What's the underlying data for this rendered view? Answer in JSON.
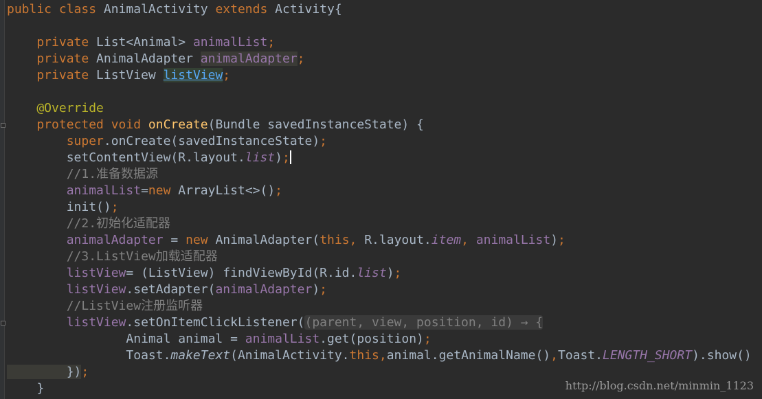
{
  "editor": {
    "lines": [
      [
        {
          "t": "public class ",
          "c": "kw"
        },
        {
          "t": "AnimalActivity ",
          "c": "pl"
        },
        {
          "t": "extends ",
          "c": "kw"
        },
        {
          "t": "Activity{",
          "c": "pl"
        }
      ],
      [],
      [
        {
          "t": "    private ",
          "c": "kw"
        },
        {
          "t": "List<Animal> ",
          "c": "pl"
        },
        {
          "t": "animalList",
          "c": "fld"
        },
        {
          "t": ";",
          "c": "kw"
        }
      ],
      [
        {
          "t": "    private ",
          "c": "kw"
        },
        {
          "t": "AnimalAdapter ",
          "c": "pl"
        },
        {
          "t": "animalAdapter",
          "c": "fld hl-usage"
        },
        {
          "t": ";",
          "c": "kw"
        }
      ],
      [
        {
          "t": "    private ",
          "c": "kw"
        },
        {
          "t": "ListView ",
          "c": "pl"
        },
        {
          "t": "listView",
          "c": "hl-link"
        },
        {
          "t": ";",
          "c": "kw"
        }
      ],
      [],
      [
        {
          "t": "    @Override",
          "c": "ann"
        }
      ],
      [
        {
          "t": "    protected void ",
          "c": "kw"
        },
        {
          "t": "onCreate",
          "c": "fn"
        },
        {
          "t": "(Bundle savedInstanceState) {",
          "c": "pl"
        }
      ],
      [
        {
          "t": "        super",
          "c": "kw"
        },
        {
          "t": ".onCreate(savedInstanceState)",
          "c": "pl"
        },
        {
          "t": ";",
          "c": "kw"
        }
      ],
      [
        {
          "t": "        setContentView(R.layout.",
          "c": "pl"
        },
        {
          "t": "list",
          "c": "fldi"
        },
        {
          "t": ")",
          "c": "pl"
        },
        {
          "t": ";",
          "c": "kw"
        },
        {
          "t": "",
          "c": "caret"
        }
      ],
      [
        {
          "t": "        //1.准备数据源",
          "c": "cmt"
        }
      ],
      [
        {
          "t": "        animalList",
          "c": "fld"
        },
        {
          "t": "=",
          "c": "pl"
        },
        {
          "t": "new ",
          "c": "kw"
        },
        {
          "t": "ArrayList<>()",
          "c": "pl"
        },
        {
          "t": ";",
          "c": "kw"
        }
      ],
      [
        {
          "t": "        init()",
          "c": "pl"
        },
        {
          "t": ";",
          "c": "kw"
        }
      ],
      [
        {
          "t": "        //2.初始化适配器",
          "c": "cmt"
        }
      ],
      [
        {
          "t": "        animalAdapter ",
          "c": "fld"
        },
        {
          "t": "= ",
          "c": "pl"
        },
        {
          "t": "new ",
          "c": "kw"
        },
        {
          "t": "AnimalAdapter(",
          "c": "pl"
        },
        {
          "t": "this, ",
          "c": "kw"
        },
        {
          "t": "R.layout.",
          "c": "pl"
        },
        {
          "t": "item",
          "c": "fldi"
        },
        {
          "t": ", ",
          "c": "kw"
        },
        {
          "t": "animalList",
          "c": "fld"
        },
        {
          "t": ")",
          "c": "pl"
        },
        {
          "t": ";",
          "c": "kw"
        }
      ],
      [
        {
          "t": "        //3.ListView加载适配器",
          "c": "cmt"
        }
      ],
      [
        {
          "t": "        listView",
          "c": "fld"
        },
        {
          "t": "= (ListView) findViewById(R.id.",
          "c": "pl"
        },
        {
          "t": "list",
          "c": "fldi"
        },
        {
          "t": ")",
          "c": "pl"
        },
        {
          "t": ";",
          "c": "kw"
        }
      ],
      [
        {
          "t": "        listView",
          "c": "fld"
        },
        {
          "t": ".setAdapter(",
          "c": "pl"
        },
        {
          "t": "animalAdapter",
          "c": "fld"
        },
        {
          "t": ")",
          "c": "pl"
        },
        {
          "t": ";",
          "c": "kw"
        }
      ],
      [
        {
          "t": "        //ListView注册监听器",
          "c": "cmt"
        }
      ],
      [
        {
          "t": "        listView",
          "c": "fld"
        },
        {
          "t": ".setOnItemClickListener(",
          "c": "pl"
        },
        {
          "t": "(parent, view, position, id) → {",
          "c": "hl-lambda"
        }
      ],
      [
        {
          "t": "                Animal animal = ",
          "c": "pl"
        },
        {
          "t": "animalList",
          "c": "fld"
        },
        {
          "t": ".get(position)",
          "c": "pl"
        },
        {
          "t": ";",
          "c": "kw"
        }
      ],
      [
        {
          "t": "                Toast.",
          "c": "pl"
        },
        {
          "t": "makeText",
          "c": "pl it"
        },
        {
          "t": "(AnimalActivity.",
          "c": "pl"
        },
        {
          "t": "this",
          "c": "kw"
        },
        {
          "t": ",",
          "c": "kw"
        },
        {
          "t": "animal.getAnimalName()",
          "c": "pl"
        },
        {
          "t": ",",
          "c": "kw"
        },
        {
          "t": "Toast.",
          "c": "pl"
        },
        {
          "t": "LENGTH_SHORT",
          "c": "fldi"
        },
        {
          "t": ").show()",
          "c": "pl"
        }
      ],
      [
        {
          "t": "        })",
          "c": "hl-usage"
        },
        {
          "t": ";",
          "c": "kw"
        }
      ],
      [
        {
          "t": "    }",
          "c": "pl"
        }
      ]
    ]
  },
  "watermark": "http://blog.csdn.net/minmin_1123"
}
